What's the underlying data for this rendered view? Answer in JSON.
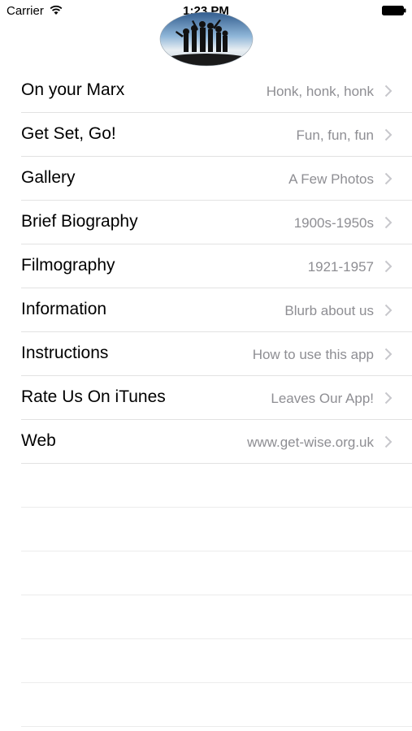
{
  "status_bar": {
    "carrier": "Carrier",
    "time": "1:23 PM",
    "wifi_icon": "wifi-icon",
    "battery_icon": "battery-icon"
  },
  "header": {
    "logo_icon": "group-silhouette-logo"
  },
  "menu": {
    "items": [
      {
        "title": "On your Marx",
        "detail": "Honk, honk, honk"
      },
      {
        "title": "Get Set, Go!",
        "detail": "Fun, fun, fun"
      },
      {
        "title": "Gallery",
        "detail": "A Few Photos"
      },
      {
        "title": "Brief Biography",
        "detail": "1900s-1950s"
      },
      {
        "title": "Filmography",
        "detail": "1921-1957"
      },
      {
        "title": "Information",
        "detail": "Blurb about us"
      },
      {
        "title": "Instructions",
        "detail": "How to use this app"
      },
      {
        "title": "Rate Us On iTunes",
        "detail": "Leaves Our App!"
      },
      {
        "title": "Web",
        "detail": "www.get-wise.org.uk"
      }
    ]
  },
  "colors": {
    "detail_text": "#8e8e93",
    "separator": "#e2e2e2",
    "chevron": "#c7c7cc"
  }
}
